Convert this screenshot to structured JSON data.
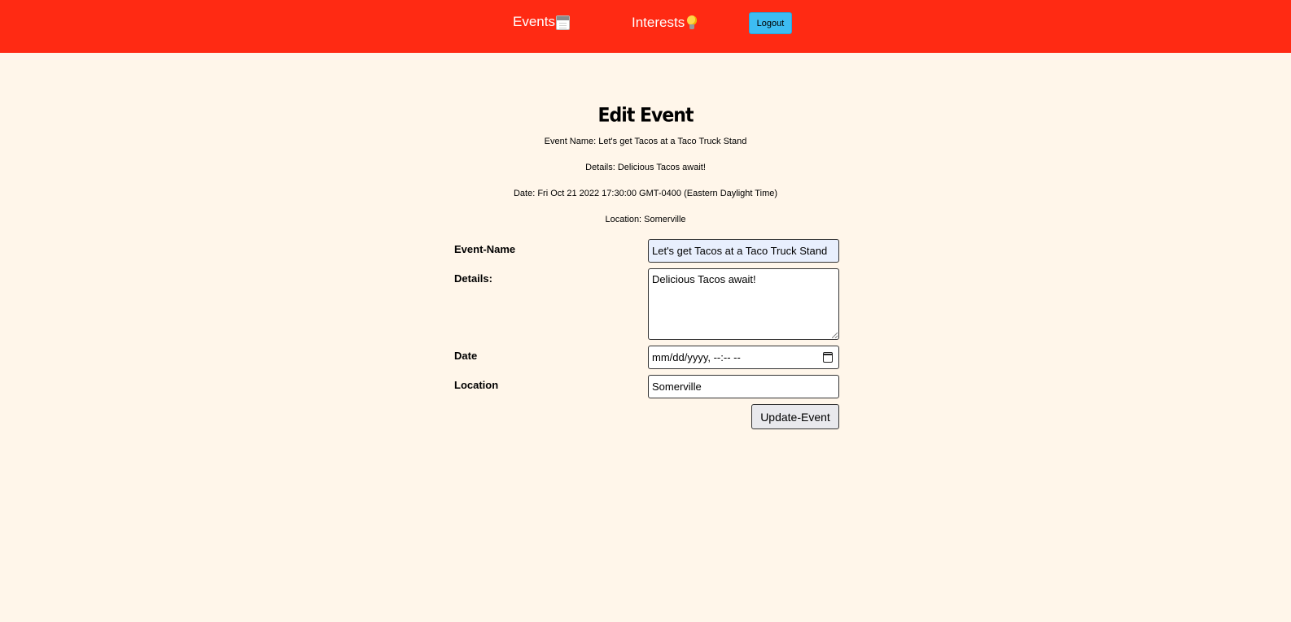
{
  "nav": {
    "events_label": "Events",
    "events_icon": "calendar-icon",
    "interests_label": "Interests",
    "interests_icon": "light-bulb-icon",
    "logout_label": "Logout",
    "bar_color": "#ff2a13",
    "logout_color": "#3dbcf2"
  },
  "page": {
    "title": "Edit Event",
    "background": "#fff6ea"
  },
  "summary": {
    "name": "Event Name: Let's get Tacos at a Taco Truck Stand",
    "details": "Details: Delicious Tacos await!",
    "date": "Date: Fri Oct 21 2022 17:30:00 GMT-0400 (Eastern Daylight Time)",
    "location": "Location: Somerville"
  },
  "form": {
    "name_label": "Event-Name",
    "name_value": "Let's get Tacos at a Taco Truck Stand",
    "details_label": "Details:",
    "details_value": "Delicious Tacos await!",
    "date_label": "Date",
    "date_placeholder": "mm/dd/yyyy, --:-- --",
    "location_label": "Location",
    "location_value": "Somerville",
    "submit_label": "Update-Event"
  }
}
